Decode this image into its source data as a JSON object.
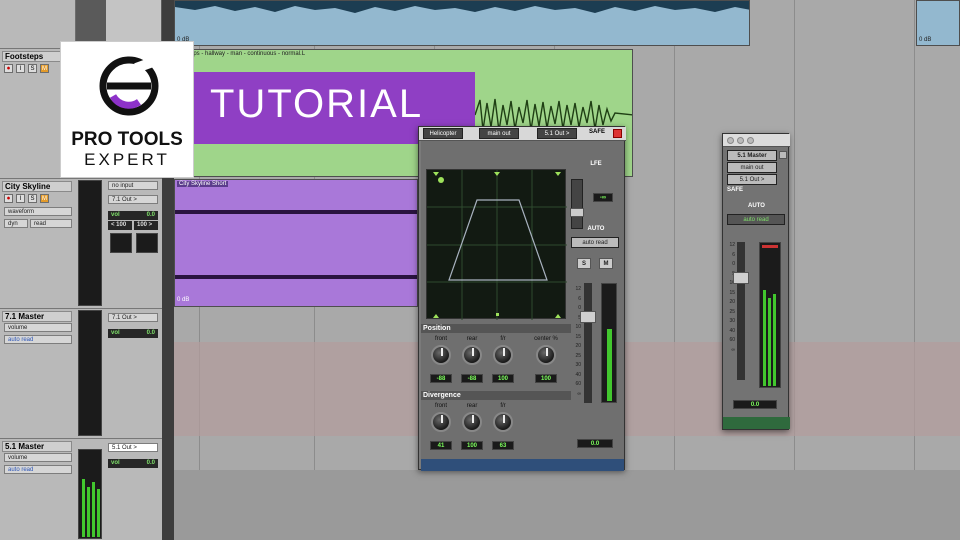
{
  "tracks": [
    {
      "name": "Footsteps",
      "buttons": [
        "⏺",
        "I",
        "S",
        "M"
      ]
    },
    {
      "name": "City Skyline",
      "io_in": "no input",
      "io_out": "7.1 Out >",
      "view": "waveform",
      "dyn": "dyn",
      "mode": "read",
      "vol_label": "vol",
      "vol_value": "0.0",
      "pan_left": "< 100",
      "pan_right": "100 >"
    },
    {
      "name": "7.1 Master",
      "io_out": "7.1 Out >",
      "view": "volume",
      "mode": "auto read",
      "vol_label": "vol",
      "vol_value": "0.0"
    },
    {
      "name": "5.1 Master",
      "io_out": "5.1 Out >",
      "view": "volume",
      "mode": "auto read",
      "vol_label": "vol",
      "vol_value": "0.0"
    }
  ],
  "clips": {
    "top_gain": "0 dB",
    "top_gain_right": "0 dB",
    "footsteps_name": "ootsteps - hallway - man - continuous - normal.L",
    "city_name": "City Skyline Short",
    "city_gain": "0 dB"
  },
  "banner": {
    "text": "TUTORIAL"
  },
  "logo": {
    "top": "PRO TOOLS",
    "bottom": "EXPERT"
  },
  "panner": {
    "track": "Helicopter",
    "output": "main out",
    "path": "5.1 Out >",
    "safe": "SAFE",
    "lfe": "LFE",
    "lfe_value": "-∞",
    "auto": "AUTO",
    "auto_mode": "auto read",
    "solo": "S",
    "mute": "M",
    "scale": [
      "12",
      "6",
      "0",
      "5",
      "10",
      "15",
      "20",
      "25",
      "30",
      "40",
      "60",
      "∞"
    ],
    "fader_value": "0.0",
    "position": {
      "title": "Position",
      "knobs": [
        {
          "label": "front",
          "value": "-88"
        },
        {
          "label": "rear",
          "value": "-88"
        },
        {
          "label": "f/r",
          "value": "100"
        },
        {
          "label": "center %",
          "value": "100"
        }
      ]
    },
    "divergence": {
      "title": "Divergence",
      "knobs": [
        {
          "label": "front",
          "value": "41"
        },
        {
          "label": "rear",
          "value": "100"
        },
        {
          "label": "f/r",
          "value": "63"
        }
      ]
    }
  },
  "output_window": {
    "title": "5.1 Master",
    "output": "main out",
    "path": "5.1 Out >",
    "safe": "SAFE",
    "auto": "AUTO",
    "auto_mode": "auto read",
    "scale": [
      "12",
      "6",
      "0",
      "5",
      "10",
      "15",
      "20",
      "25",
      "30",
      "40",
      "60",
      "∞"
    ],
    "fader_value": "0.0"
  },
  "colors": {
    "accent": "#8d32c9",
    "clip_green": "#9fd58a",
    "clip_purple": "#a978d9",
    "meter": "#42c72e",
    "timeline": "#a9a9a9"
  }
}
